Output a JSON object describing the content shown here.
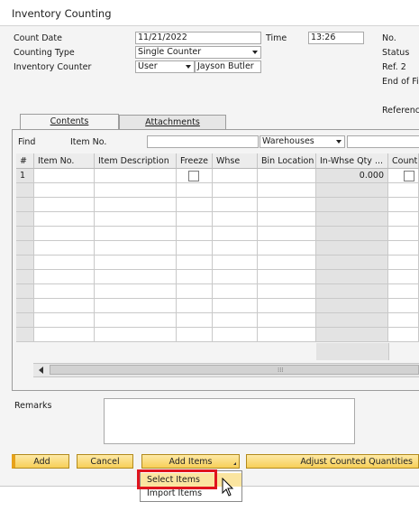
{
  "window": {
    "title": "Inventory Counting"
  },
  "header": {
    "count_date_label": "Count Date",
    "count_date_value": "11/21/2022",
    "time_label": "Time",
    "time_value": "13:26",
    "no_label": "No.",
    "counting_type_label": "Counting Type",
    "counting_type_value": "Single Counter",
    "status_label": "Status",
    "inventory_counter_label": "Inventory Counter",
    "counter_type_value": "User",
    "counter_name_value": "Jayson Butler",
    "ref2_label": "Ref. 2",
    "end_of_fiscal_label": "End of Fi",
    "reference_label": "Reference"
  },
  "tabs": [
    {
      "label": "Contents",
      "active": true
    },
    {
      "label": "Attachments",
      "active": false
    }
  ],
  "find": {
    "find_label": "Find",
    "item_no_label": "Item No.",
    "item_no_value": "",
    "warehouses_value": "Warehouses",
    "extra_value": ""
  },
  "grid": {
    "columns": [
      "#",
      "Item No.",
      "Item Description",
      "Freeze",
      "Whse",
      "Bin Location",
      "In-Whse Qty ...",
      "Count"
    ],
    "rows": [
      {
        "num": "1",
        "item_no": "",
        "description": "",
        "freeze": false,
        "whse": "",
        "bin": "",
        "in_whse_qty": "0.000",
        "counted": false
      }
    ],
    "empty_rows": 11
  },
  "remarks": {
    "label": "Remarks",
    "value": ""
  },
  "buttons": {
    "add": "Add",
    "cancel": "Cancel",
    "add_items": "Add Items",
    "adjust": "Adjust Counted Quantities"
  },
  "add_items_menu": {
    "items": [
      "Select Items",
      "Import Items"
    ],
    "highlighted": "Select Items"
  },
  "colors": {
    "accent": "#f7cf58",
    "highlight_border": "#e0141e"
  }
}
